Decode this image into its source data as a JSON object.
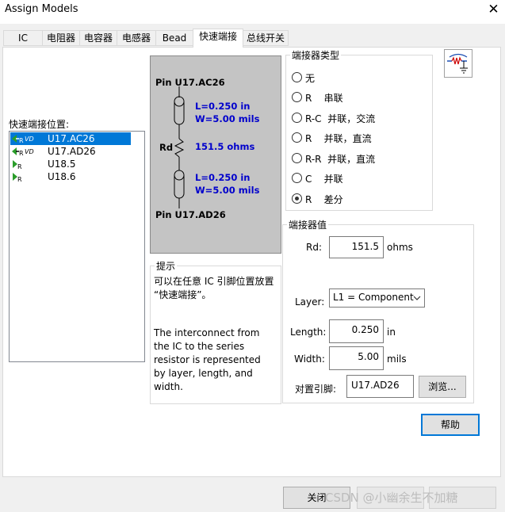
{
  "window": {
    "title": "Assign Models",
    "close_glyph": "✕"
  },
  "tabs": [
    {
      "label": "IC",
      "active": false
    },
    {
      "label": "电阻器",
      "active": false
    },
    {
      "label": "电容器",
      "active": false
    },
    {
      "label": "电感器",
      "active": false
    },
    {
      "label": "Bead",
      "active": false
    },
    {
      "label": "快速端接",
      "active": true
    },
    {
      "label": "总线开关",
      "active": false
    }
  ],
  "left": {
    "list_label": "快速端接位置:",
    "items": [
      {
        "label": "U17.AC26",
        "icon": "resistor-vd-icon",
        "selected": true
      },
      {
        "label": "U17.AD26",
        "icon": "resistor-vd-icon",
        "selected": false
      },
      {
        "label": "U18.5",
        "icon": "resistor-icon",
        "selected": false
      },
      {
        "label": "U18.6",
        "icon": "resistor-icon",
        "selected": false
      }
    ]
  },
  "diagram": {
    "pin_top": "Pin U17.AC26",
    "seg1_l": "L=0.250 in",
    "seg1_w": "W=5.00 mils",
    "rd_label": "Rd",
    "rd_value": "151.5 ohms",
    "seg2_l": "L=0.250 in",
    "seg2_w": "W=5.00 mils",
    "pin_bottom": "Pin U17.AD26",
    "colors": {
      "blue_text": "#0000cc",
      "background": "#c4c4c4"
    }
  },
  "hint": {
    "title": "提示",
    "text1_line1": "可以在任意 IC 引脚位置放置",
    "text1_line2": "“快速端接”。",
    "text2_line1": "The interconnect from",
    "text2_line2": "the IC to the series",
    "text2_line3": "resistor is represented",
    "text2_line4": "by layer, length, and",
    "text2_line5": "width."
  },
  "terminator_type": {
    "title": "端接器类型",
    "options": [
      {
        "label": "无",
        "selected": false
      },
      {
        "label": "R    串联",
        "selected": false
      },
      {
        "label": "R-C  并联，交流",
        "selected": false
      },
      {
        "label": "R    并联，直流",
        "selected": false
      },
      {
        "label": "R-R  并联，直流",
        "selected": false
      },
      {
        "label": "C    并联",
        "selected": false
      },
      {
        "label": "R    差分",
        "selected": true
      }
    ]
  },
  "terminator_values": {
    "title": "端接器值",
    "rd_label": "Rd:",
    "rd_value": "151.5",
    "rd_unit": "ohms",
    "layer_label": "Layer:",
    "layer_value": "L1 = Component",
    "length_label": "Length:",
    "length_value": "0.250",
    "length_unit": "in",
    "width_label": "Width:",
    "width_value": "5.00",
    "width_unit": "mils",
    "pair_label": "对置引脚:",
    "pair_value": "U17.AD26",
    "browse_label": "浏览..."
  },
  "buttons": {
    "help": "帮助",
    "close": "关闭"
  },
  "watermark": "CSDN @小幽余生不加糖"
}
